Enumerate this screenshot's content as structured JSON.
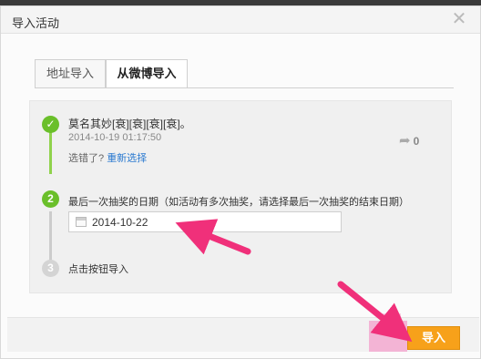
{
  "dialog": {
    "title": "导入活动",
    "close_glyph": "✕"
  },
  "tabs": [
    {
      "label": "地址导入",
      "active": false
    },
    {
      "label": "从微博导入",
      "active": true
    }
  ],
  "step1": {
    "number": "✓",
    "post_text": "莫名其妙[衰][衰][衰][衰]。",
    "timestamp": "2014-10-19 01:17:50",
    "question": "选错了?",
    "reselect_link": "重新选择",
    "repost_icon": "repost-arrow-icon",
    "repost_count": "0"
  },
  "step2": {
    "number": "2",
    "instruction": "最后一次抽奖的日期（如活动有多次抽奖，请选择最后一次抽奖的结束日期）",
    "date_value": "2014-10-22"
  },
  "step3": {
    "number": "3",
    "instruction": "点击按钮导入"
  },
  "footer": {
    "import_label": "导入"
  },
  "colors": {
    "step_done": "#6abf2a",
    "step_line_done": "#8fd24c",
    "step_pending": "#d4d4d4",
    "link": "#2b7ad0",
    "import_button": "#f7a11a",
    "annotation_arrow": "#f0307a"
  }
}
